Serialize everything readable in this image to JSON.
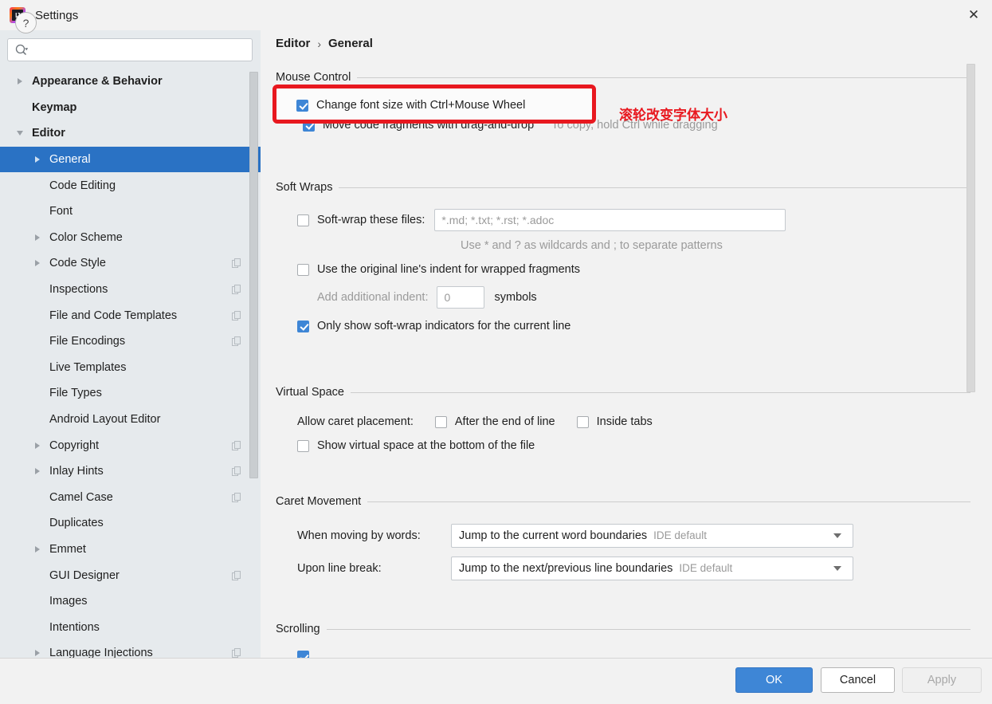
{
  "window": {
    "title": "Settings",
    "logo_icon": "intellij-idea-logo",
    "close_icon": "close-icon",
    "close_label": "✕"
  },
  "sidebar": {
    "search": {
      "placeholder": "",
      "value": "",
      "icon": "search-icon"
    },
    "items": [
      {
        "label": "Appearance & Behavior",
        "indent": 0,
        "arrow": "right",
        "bold": true,
        "selected": false,
        "copyable": false
      },
      {
        "label": "Keymap",
        "indent": 0,
        "arrow": "none",
        "bold": true,
        "selected": false,
        "copyable": false
      },
      {
        "label": "Editor",
        "indent": 0,
        "arrow": "down",
        "bold": true,
        "selected": false,
        "copyable": false
      },
      {
        "label": "General",
        "indent": 1,
        "arrow": "right",
        "bold": false,
        "selected": true,
        "copyable": false
      },
      {
        "label": "Code Editing",
        "indent": 1,
        "arrow": "none",
        "bold": false,
        "selected": false,
        "copyable": false
      },
      {
        "label": "Font",
        "indent": 1,
        "arrow": "none",
        "bold": false,
        "selected": false,
        "copyable": false
      },
      {
        "label": "Color Scheme",
        "indent": 1,
        "arrow": "right",
        "bold": false,
        "selected": false,
        "copyable": false
      },
      {
        "label": "Code Style",
        "indent": 1,
        "arrow": "right",
        "bold": false,
        "selected": false,
        "copyable": true
      },
      {
        "label": "Inspections",
        "indent": 1,
        "arrow": "none",
        "bold": false,
        "selected": false,
        "copyable": true
      },
      {
        "label": "File and Code Templates",
        "indent": 1,
        "arrow": "none",
        "bold": false,
        "selected": false,
        "copyable": true
      },
      {
        "label": "File Encodings",
        "indent": 1,
        "arrow": "none",
        "bold": false,
        "selected": false,
        "copyable": true
      },
      {
        "label": "Live Templates",
        "indent": 1,
        "arrow": "none",
        "bold": false,
        "selected": false,
        "copyable": false
      },
      {
        "label": "File Types",
        "indent": 1,
        "arrow": "none",
        "bold": false,
        "selected": false,
        "copyable": false
      },
      {
        "label": "Android Layout Editor",
        "indent": 1,
        "arrow": "none",
        "bold": false,
        "selected": false,
        "copyable": false
      },
      {
        "label": "Copyright",
        "indent": 1,
        "arrow": "right",
        "bold": false,
        "selected": false,
        "copyable": true
      },
      {
        "label": "Inlay Hints",
        "indent": 1,
        "arrow": "right",
        "bold": false,
        "selected": false,
        "copyable": true
      },
      {
        "label": "Camel Case",
        "indent": 1,
        "arrow": "none",
        "bold": false,
        "selected": false,
        "copyable": true
      },
      {
        "label": "Duplicates",
        "indent": 1,
        "arrow": "none",
        "bold": false,
        "selected": false,
        "copyable": false
      },
      {
        "label": "Emmet",
        "indent": 1,
        "arrow": "right",
        "bold": false,
        "selected": false,
        "copyable": false
      },
      {
        "label": "GUI Designer",
        "indent": 1,
        "arrow": "none",
        "bold": false,
        "selected": false,
        "copyable": true
      },
      {
        "label": "Images",
        "indent": 1,
        "arrow": "none",
        "bold": false,
        "selected": false,
        "copyable": false
      },
      {
        "label": "Intentions",
        "indent": 1,
        "arrow": "none",
        "bold": false,
        "selected": false,
        "copyable": false
      },
      {
        "label": "Language Injections",
        "indent": 1,
        "arrow": "right",
        "bold": false,
        "selected": false,
        "copyable": true
      }
    ]
  },
  "breadcrumb": {
    "parent": "Editor",
    "separator": "›",
    "current": "General"
  },
  "sections": {
    "mouse_control": {
      "title": "Mouse Control",
      "change_font_size": {
        "label": "Change font size with Ctrl+Mouse Wheel",
        "checked": true
      },
      "move_code_fragments": {
        "label": "Move code fragments with drag-and-drop",
        "checked": true
      },
      "move_code_hint": "To copy, hold Ctrl while dragging"
    },
    "soft_wraps": {
      "title": "Soft Wraps",
      "soft_wrap_files": {
        "label": "Soft-wrap these files:",
        "checked": false
      },
      "soft_wrap_files_value": "*.md; *.txt; *.rst; *.adoc",
      "wildcard_hint": "Use * and ? as wildcards and ; to separate patterns",
      "original_indent": {
        "label": "Use the original line's indent for wrapped fragments",
        "checked": false
      },
      "add_indent_label": "Add additional indent:",
      "add_indent_value": "0",
      "symbols_label": "symbols",
      "only_show_indicators": {
        "label": "Only show soft-wrap indicators for the current line",
        "checked": true
      }
    },
    "virtual_space": {
      "title": "Virtual Space",
      "allow_caret_label": "Allow caret placement:",
      "after_end_of_line": {
        "label": "After the end of line",
        "checked": false
      },
      "inside_tabs": {
        "label": "Inside tabs",
        "checked": false
      },
      "show_virtual_space": {
        "label": "Show virtual space at the bottom of the file",
        "checked": false
      }
    },
    "caret_movement": {
      "title": "Caret Movement",
      "when_moving_label": "When moving by words:",
      "when_moving_value": "Jump to the current word boundaries",
      "when_moving_suffix": "IDE default",
      "upon_line_break_label": "Upon line break:",
      "upon_line_break_value": "Jump to the next/previous line boundaries",
      "upon_line_break_suffix": "IDE default"
    },
    "scrolling": {
      "title": "Scrolling"
    }
  },
  "annotation": {
    "text": "滚轮改变字体大小",
    "color": "#e8181f"
  },
  "footer": {
    "help_icon": "help-icon",
    "help_label": "?",
    "ok": "OK",
    "cancel": "Cancel",
    "apply": "Apply"
  },
  "colors": {
    "accent": "#3e86d6",
    "selection": "#2a72c4",
    "sidebar_bg": "#e6eaed",
    "content_bg": "#f2f2f2",
    "annotation_red": "#e8181f"
  }
}
